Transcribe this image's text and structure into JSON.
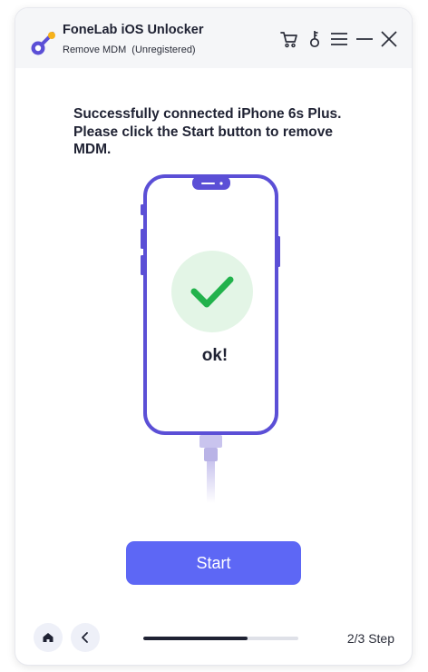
{
  "app": {
    "title": "FoneLab iOS Unlocker",
    "mode": "Remove MDM",
    "registration": "(Unregistered)"
  },
  "titlebar_icons": [
    "cart-icon",
    "key-icon",
    "menu-icon",
    "minimize-icon",
    "close-icon"
  ],
  "main": {
    "message": "Successfully connected iPhone 6s Plus. Please click the Start button to remove MDM.",
    "status_label": "ok!",
    "start_label": "Start"
  },
  "footer": {
    "step_label": "2/3 Step",
    "progress_fraction": 0.67
  },
  "colors": {
    "accent": "#5d67f5",
    "phone_frame": "#5b4fd6",
    "check_green": "#22b24c",
    "check_circle": "#e3f5e6",
    "cable": "#c9c4ee"
  }
}
